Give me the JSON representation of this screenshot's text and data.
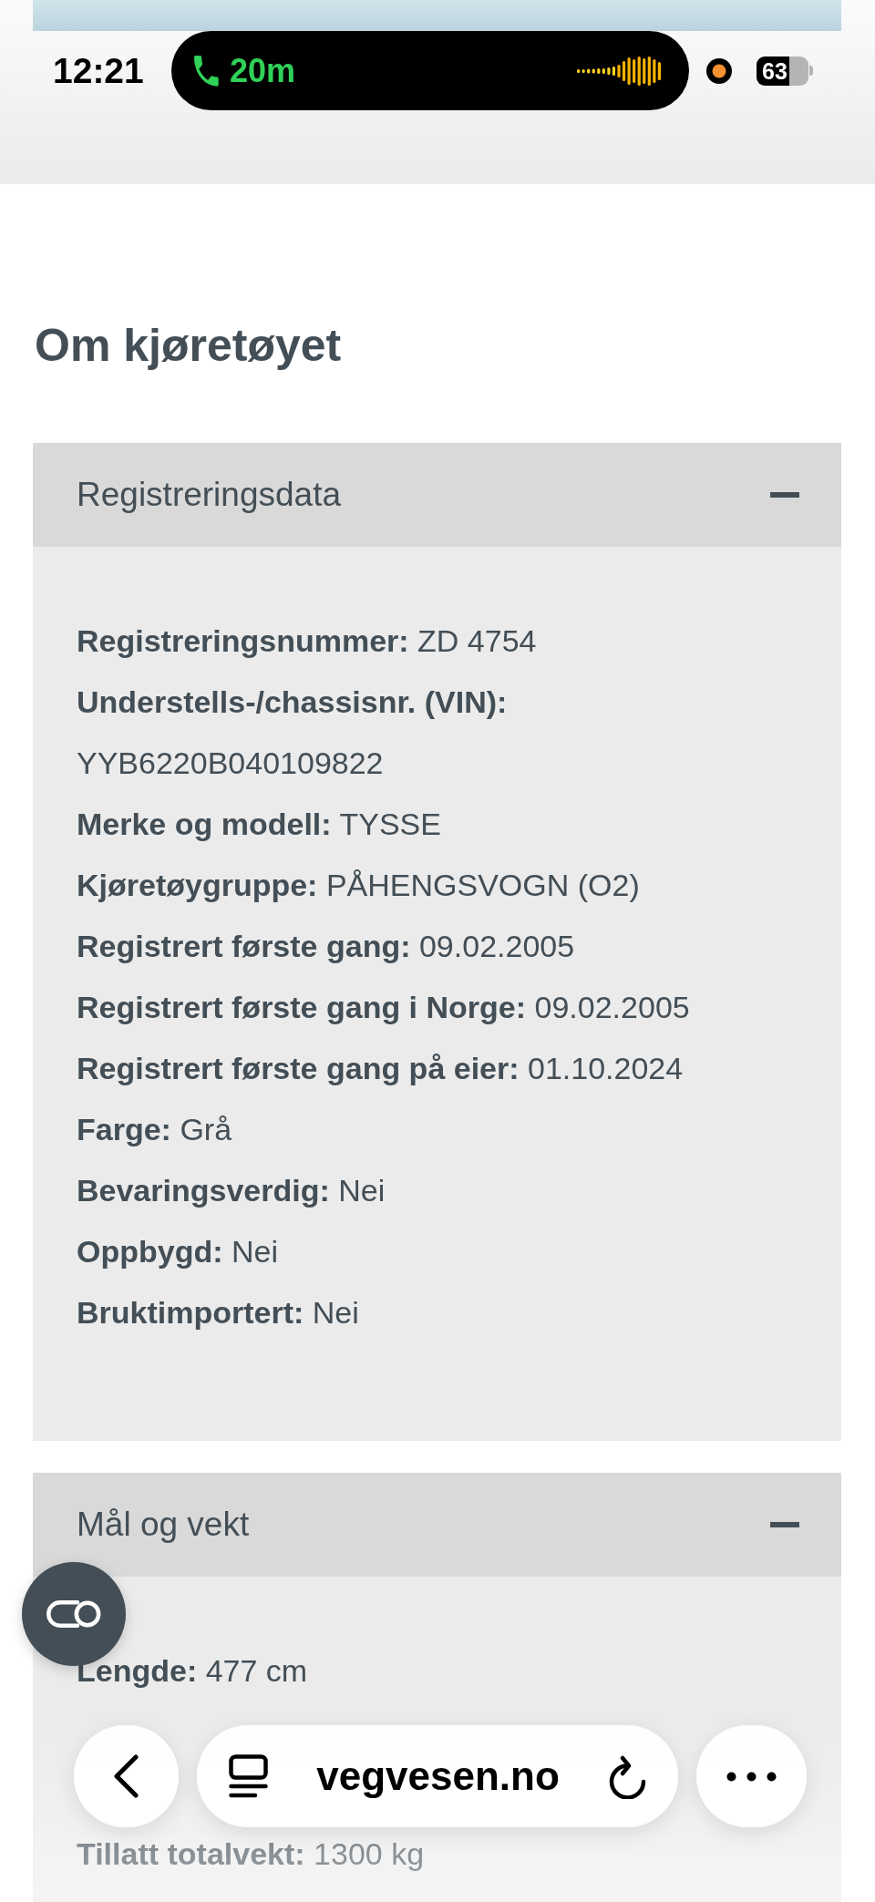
{
  "status_bar": {
    "time": "12:21",
    "call_duration": "20m",
    "battery": "63"
  },
  "page": {
    "title": "Om kjøretøyet",
    "sections": [
      {
        "title": "Registreringsdata",
        "expanded": true,
        "rows": [
          {
            "label": "Registreringsnummer:",
            "value": "ZD 4754"
          },
          {
            "label": "Understells-/chassisnr. (VIN):",
            "value": "YYB6220B040109822"
          },
          {
            "label": "Merke og modell:",
            "value": "TYSSE"
          },
          {
            "label": "Kjøretøygruppe:",
            "value": "PÅHENGSVOGN (O2)"
          },
          {
            "label": "Registrert første gang:",
            "value": "09.02.2005"
          },
          {
            "label": "Registrert første gang i Norge:",
            "value": "09.02.2005"
          },
          {
            "label": "Registrert første gang på eier:",
            "value": "01.10.2024"
          },
          {
            "label": "Farge:",
            "value": "Grå"
          },
          {
            "label": "Bevaringsverdig:",
            "value": "Nei"
          },
          {
            "label": "Oppbygd:",
            "value": "Nei"
          },
          {
            "label": "Bruktimportert:",
            "value": "Nei"
          }
        ]
      },
      {
        "title": "Mål og vekt",
        "expanded": true,
        "rows": [
          {
            "label": "Lengde:",
            "value": "477 cm"
          },
          {
            "label": "Tillatt totalvekt:",
            "value": "1300 kg"
          }
        ]
      }
    ]
  },
  "browser_toolbar": {
    "url": "vegvesen.no"
  }
}
